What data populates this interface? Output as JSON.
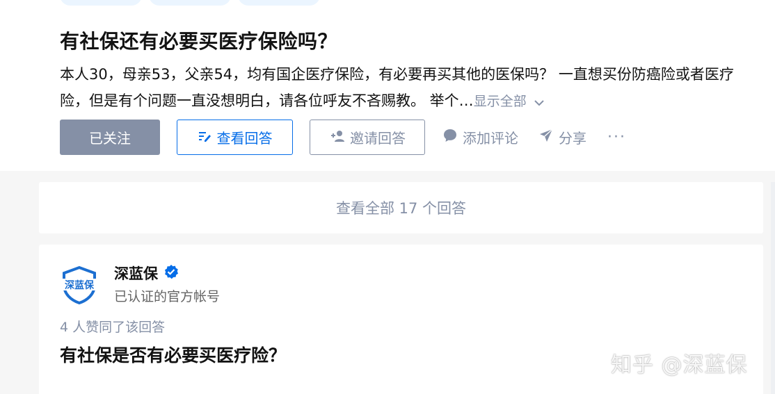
{
  "question": {
    "title": "有社保还有必要买医疗保险吗？",
    "excerpt": "本人30，母亲53，父亲54，均有国企医疗保险，有必要再买其他的医保吗？ 一直想买份防癌险或者医疗险，但是有个问题一直没想明白，请各位呼友不吝赐教。 举个…",
    "show_all": "显示全部"
  },
  "actions": {
    "followed": "已关注",
    "view_answers": "查看回答",
    "invite": "邀请回答",
    "comment": "添加评论",
    "share": "分享",
    "more": "···"
  },
  "view_all": "查看全部 17 个回答",
  "answer": {
    "author_name": "深蓝保",
    "author_desc": "已认证的官方帐号",
    "avatar_text": "深蓝保",
    "voters": "4 人赞同了该回答",
    "title": "有社保是否有必要买医疗险？"
  },
  "watermark": "知乎 @深蓝保",
  "colors": {
    "brand_blue": "#056de8",
    "muted": "#8590a6",
    "followed_bg": "#8590a6"
  },
  "icons": [
    "chevron-down-icon",
    "answer-edit-icon",
    "invite-user-icon",
    "comment-bubble-icon",
    "share-paper-plane-icon",
    "verified-badge-icon",
    "shield-logo-icon"
  ]
}
